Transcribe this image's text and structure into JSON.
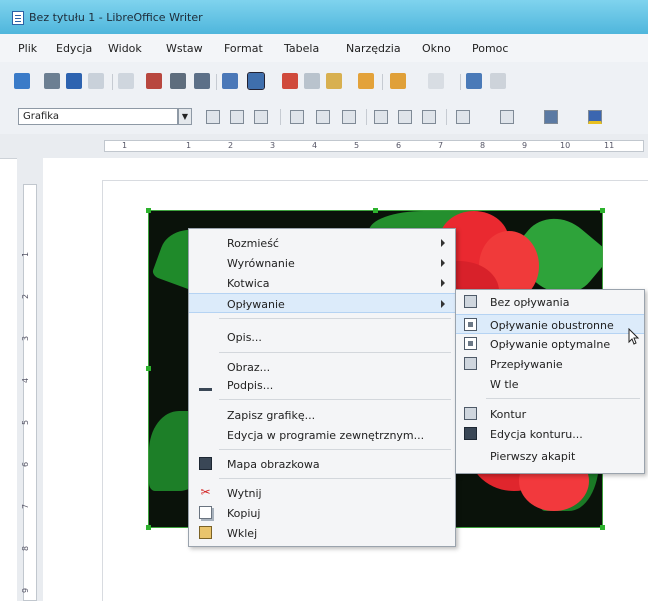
{
  "window": {
    "title": "Bez tytułu 1 - LibreOffice Writer"
  },
  "menubar": [
    "Plik",
    "Edycja",
    "Widok",
    "Wstaw",
    "Format",
    "Tabela",
    "Narzędzia",
    "Okno",
    "Pomoc"
  ],
  "toolbar2": {
    "style_value": "Grafika"
  },
  "ruler": {
    "h_ticks": [
      "1",
      "1",
      "2",
      "3",
      "4",
      "5",
      "6",
      "7",
      "8",
      "9",
      "10",
      "11"
    ],
    "v_ticks": [
      "1",
      "2",
      "3",
      "4",
      "5",
      "6",
      "7",
      "8",
      "9"
    ]
  },
  "context_menu": {
    "items": [
      {
        "label": "Rozmieść",
        "submenu": true
      },
      {
        "label": "Wyrównanie",
        "submenu": true
      },
      {
        "label": "Kotwica",
        "submenu": true
      },
      {
        "label": "Opływanie",
        "submenu": true,
        "highlighted": true
      },
      {
        "label": "Opis..."
      },
      {
        "label": "Obraz..."
      },
      {
        "label": "Podpis..."
      },
      {
        "label": "Zapisz grafikę..."
      },
      {
        "label": "Edycja w programie zewnętrznym..."
      },
      {
        "label": "Mapa obrazkowa"
      },
      {
        "label": "Wytnij"
      },
      {
        "label": "Kopiuj"
      },
      {
        "label": "Wklej"
      }
    ]
  },
  "submenu": {
    "items": [
      {
        "label": "Bez opływania"
      },
      {
        "label": "Opływanie obustronne",
        "highlighted": true
      },
      {
        "label": "Opływanie optymalne"
      },
      {
        "label": "Przepływanie"
      },
      {
        "label": "W tle"
      },
      {
        "label": "Kontur"
      },
      {
        "label": "Edycja konturu..."
      },
      {
        "label": "Pierwszy akapit"
      }
    ]
  }
}
